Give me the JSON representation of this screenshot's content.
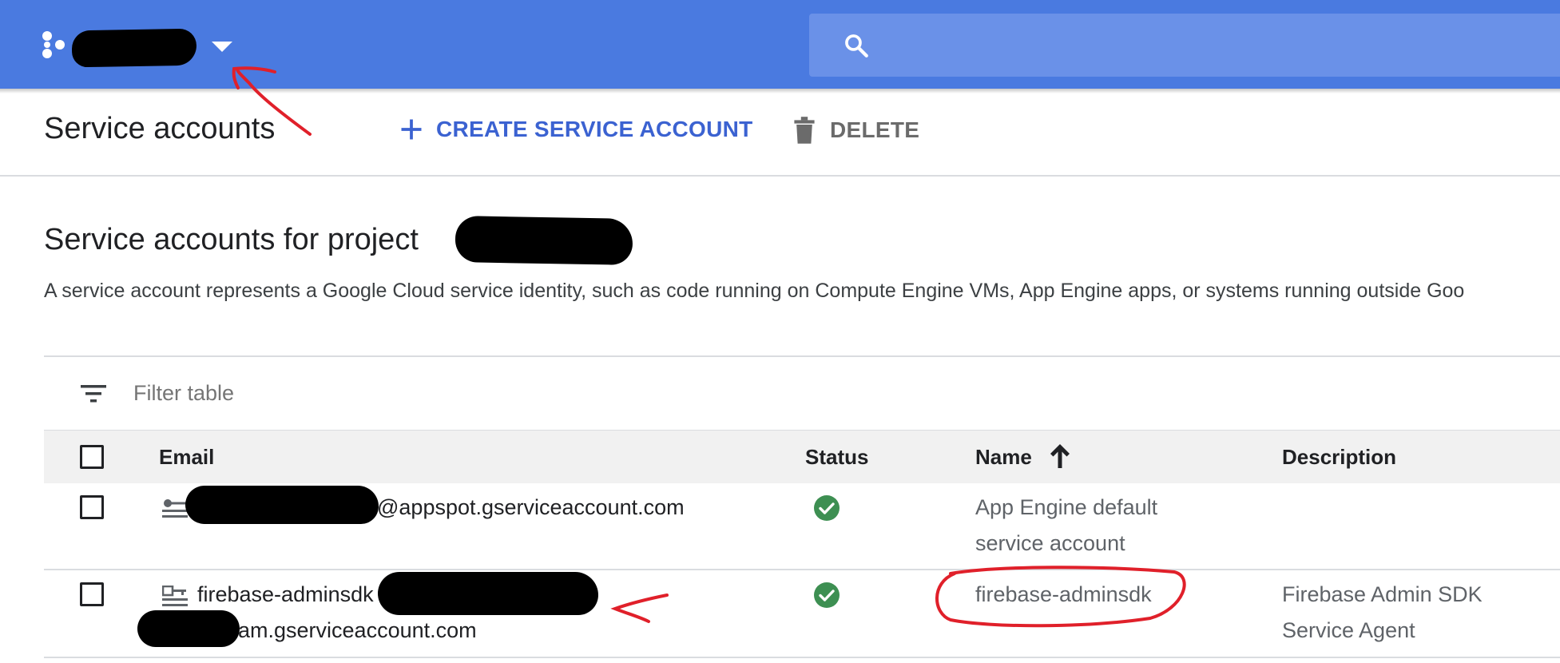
{
  "topbar": {
    "search_placeholder": ""
  },
  "toolbar": {
    "title": "Service accounts",
    "create_label": "CREATE SERVICE ACCOUNT",
    "delete_label": "DELETE"
  },
  "section": {
    "title": "Service accounts for project",
    "description": "A service account represents a Google Cloud service identity, such as code running on Compute Engine VMs, App Engine apps, or systems running outside Goo"
  },
  "filter": {
    "placeholder": "Filter table"
  },
  "table": {
    "columns": {
      "email": "Email",
      "status": "Status",
      "name": "Name",
      "description": "Description"
    },
    "sort": {
      "column": "Name",
      "direction": "ascending"
    },
    "rows": [
      {
        "email_visible": "@appspot.gserviceaccount.com",
        "status": "enabled",
        "name_line1": "App Engine default",
        "name_line2": "service account",
        "description_line1": "",
        "description_line2": ""
      },
      {
        "email_line1": "firebase-adminsdk",
        "email_line2": "am.gserviceaccount.com",
        "status": "enabled",
        "name_line1": "firebase-adminsdk",
        "description_line1": "Firebase Admin SDK",
        "description_line2": "Service Agent"
      }
    ]
  },
  "colors": {
    "topbar": "#4a7ae0",
    "accent": "#3b62d1",
    "status_ok": "#3d8f52",
    "annotation": "#e0202a"
  }
}
